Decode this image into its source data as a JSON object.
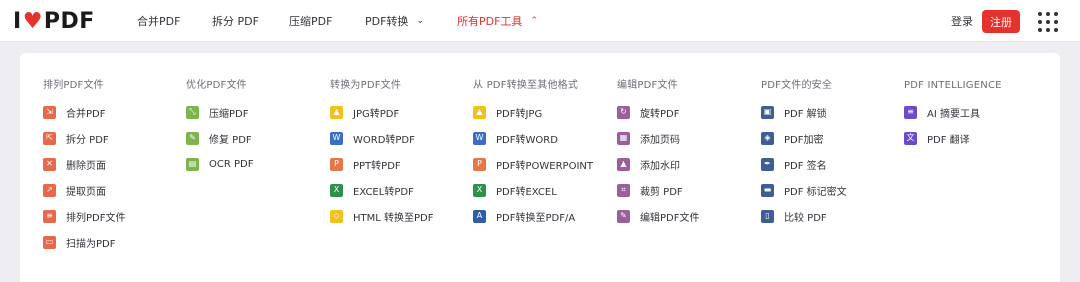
{
  "header": {
    "logo": {
      "left": "I",
      "right": "PDF"
    },
    "nav": [
      {
        "label": "合并PDF"
      },
      {
        "label": "拆分 PDF"
      },
      {
        "label": "压缩PDF"
      },
      {
        "label": "PDF转换"
      },
      {
        "label": "所有PDF工具"
      }
    ],
    "login_label": "登录",
    "register_label": "注册"
  },
  "colors": {
    "accent": "#e5322d"
  },
  "menu": {
    "columns": [
      {
        "title": "排列PDF文件",
        "tools": [
          {
            "label": "合并PDF",
            "icon": "merge-icon",
            "color": "#e5694a"
          },
          {
            "label": "拆分 PDF",
            "icon": "split-icon",
            "color": "#e5694a"
          },
          {
            "label": "删除页面",
            "icon": "delete-pages-icon",
            "color": "#e5694a"
          },
          {
            "label": "提取页面",
            "icon": "extract-pages-icon",
            "color": "#e5694a"
          },
          {
            "label": "排列PDF文件",
            "icon": "organize-icon",
            "color": "#e5694a"
          },
          {
            "label": "扫描为PDF",
            "icon": "scan-icon",
            "color": "#e5694a"
          }
        ]
      },
      {
        "title": "优化PDF文件",
        "tools": [
          {
            "label": "压缩PDF",
            "icon": "compress-icon",
            "color": "#7fb34d"
          },
          {
            "label": "修复 PDF",
            "icon": "repair-icon",
            "color": "#7fb34d"
          },
          {
            "label": "OCR PDF",
            "icon": "ocr-icon",
            "color": "#7fb34d"
          }
        ]
      },
      {
        "title": "转换为PDF文件",
        "tools": [
          {
            "label": "JPG转PDF",
            "icon": "jpg-file-icon",
            "color": "#f2c11c"
          },
          {
            "label": "WORD转PDF",
            "icon": "word-file-icon",
            "color": "#3a6ec2"
          },
          {
            "label": "PPT转PDF",
            "icon": "ppt-file-icon",
            "color": "#e5784a"
          },
          {
            "label": "EXCEL转PDF",
            "icon": "excel-file-icon",
            "color": "#2f8f4e"
          },
          {
            "label": "HTML 转换至PDF",
            "icon": "html-file-icon",
            "color": "#f2c11c"
          }
        ]
      },
      {
        "title": "从 PDF转换至其他格式",
        "tools": [
          {
            "label": "PDF转JPG",
            "icon": "jpg-file-icon",
            "color": "#f2c11c"
          },
          {
            "label": "PDF转WORD",
            "icon": "word-file-icon",
            "color": "#3a6ec2"
          },
          {
            "label": "PDF转POWERPOINT",
            "icon": "ppt-file-icon",
            "color": "#e5784a"
          },
          {
            "label": "PDF转EXCEL",
            "icon": "excel-file-icon",
            "color": "#2f8f4e"
          },
          {
            "label": "PDF转换至PDF/A",
            "icon": "pdfa-file-icon",
            "color": "#2f5ea8"
          }
        ]
      },
      {
        "title": "编辑PDF文件",
        "tools": [
          {
            "label": "旋转PDF",
            "icon": "rotate-icon",
            "color": "#9a5f9c"
          },
          {
            "label": "添加页码",
            "icon": "page-numbers-icon",
            "color": "#9a5f9c"
          },
          {
            "label": "添加水印",
            "icon": "watermark-icon",
            "color": "#9a5f9c"
          },
          {
            "label": "裁剪 PDF",
            "icon": "crop-icon",
            "color": "#9a5f9c"
          },
          {
            "label": "编辑PDF文件",
            "icon": "edit-icon",
            "color": "#9a5f9c"
          }
        ]
      },
      {
        "title": "PDF文件的安全",
        "tools": [
          {
            "label": "PDF 解锁",
            "icon": "unlock-icon",
            "color": "#3d5f93"
          },
          {
            "label": "PDF加密",
            "icon": "protect-icon",
            "color": "#3d5f93"
          },
          {
            "label": "PDF 签名",
            "icon": "sign-icon",
            "color": "#3d5f93"
          },
          {
            "label": "PDF 标记密文",
            "icon": "redact-icon",
            "color": "#3d5f93"
          },
          {
            "label": "比较 PDF",
            "icon": "compare-icon",
            "color": "#3d5f93"
          }
        ]
      },
      {
        "title": "PDF INTELLIGENCE",
        "tools": [
          {
            "label": "AI 摘要工具",
            "icon": "ai-summary-icon",
            "color": "#6c4bc9"
          },
          {
            "label": "PDF 翻译",
            "icon": "translate-icon",
            "color": "#6c4bc9"
          }
        ]
      }
    ]
  }
}
